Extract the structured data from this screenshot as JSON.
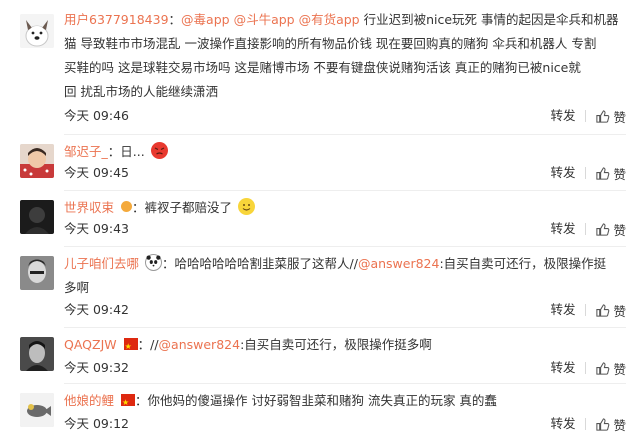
{
  "comments": [
    {
      "user": "用户6377918439",
      "mentions": [
        "@毒app",
        "@斗牛app",
        "@有货app"
      ],
      "text_lines": [
        "行业迟到被nice玩死 事情的起因是伞兵和机器",
        "猫 导致鞋市市场混乱 一波操作直接影响的所有物品价钱 现在要回购真的赌狗 伞兵和机器人 专割",
        "买鞋的吗 这是球鞋交易市场吗 这是赌博市场 不要有键盘侠说赌狗活该 真正的赌狗已被nice就",
        "回 扰乱市场的人能继续潇洒"
      ],
      "time": "今天 09:46",
      "repost": "转发",
      "like": "赞"
    },
    {
      "user": "邹迟子_",
      "text": "：日...",
      "time": "今天 09:45",
      "repost": "转发",
      "like": "赞"
    },
    {
      "user": "世界収束",
      "text": "裤衩子都赔没了",
      "time": "今天 09:43",
      "repost": "转发",
      "like": "赞"
    },
    {
      "user": "儿子咱们去哪",
      "text": "哈哈哈哈哈哈割韭菜服了这帮人//",
      "mention": "@answer824",
      "text_after": ":自买自卖可还行，极限操作挺",
      "text_line2": "多啊",
      "time": "今天 09:42",
      "repost": "转发",
      "like": "赞"
    },
    {
      "user": "QAQZJW",
      "text": "：//",
      "mention": "@answer824",
      "text_after": ":自买自卖可还行，极限操作挺多啊",
      "time": "今天 09:32",
      "repost": "转发",
      "like": "赞"
    },
    {
      "user": "他娘的鲤",
      "text": "：你他妈的傻逼操作 讨好弱智韭菜和赌狗 流失真正的玩家 真的蠢",
      "time": "今天 09:12",
      "repost": "转发",
      "like": "赞"
    }
  ],
  "colors": {
    "accent": "#eb7350",
    "text": "#333333",
    "divider": "#eeeeee"
  },
  "icons": [
    "thumbs-up-icon",
    "emoji-angry-icon",
    "emoji-smile-icon",
    "emoji-panda-icon",
    "china-flag-icon"
  ]
}
